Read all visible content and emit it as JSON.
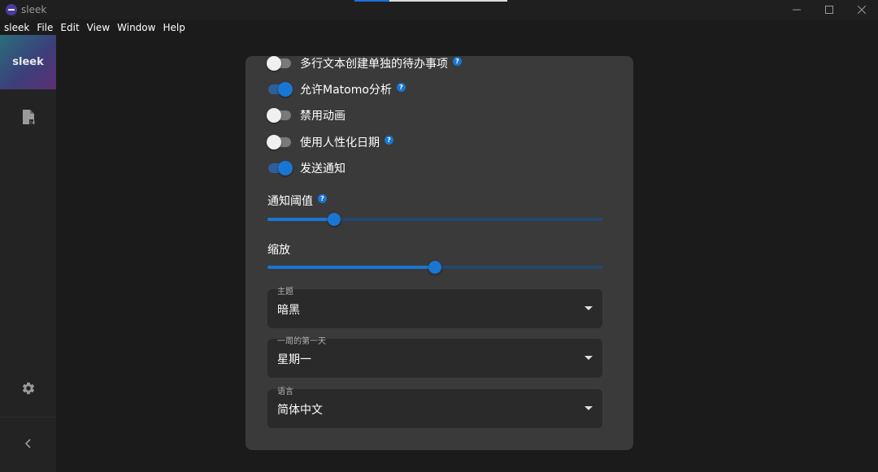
{
  "window": {
    "title": "sleek",
    "controls": {
      "minimize": "—",
      "maximize": "☐",
      "close": "✕"
    }
  },
  "menubar": {
    "items": [
      "sleek",
      "File",
      "Edit",
      "View",
      "Window",
      "Help"
    ]
  },
  "sidebar": {
    "logo_text": "sleek"
  },
  "settings": {
    "toggles": [
      {
        "label": "多行文本创建单独的待办事项",
        "on": false,
        "help": true
      },
      {
        "label": "允许Matomo分析",
        "on": true,
        "help": true
      },
      {
        "label": "禁用动画",
        "on": false,
        "help": false
      },
      {
        "label": "使用人性化日期",
        "on": false,
        "help": true
      },
      {
        "label": "发送通知",
        "on": true,
        "help": false
      }
    ],
    "notification_threshold": {
      "label": "通知阈值",
      "value_fraction": 0.2,
      "help": true
    },
    "zoom": {
      "label": "缩放",
      "value_fraction": 0.5
    },
    "theme": {
      "label": "主题",
      "value": "暗黑"
    },
    "week_start": {
      "label": "一周的第一天",
      "value": "星期一"
    },
    "language": {
      "label": "语言",
      "value": "简体中文"
    }
  },
  "colors": {
    "accent": "#1976d2",
    "panel": "#3a3a3a",
    "background": "#1b1b1b"
  }
}
